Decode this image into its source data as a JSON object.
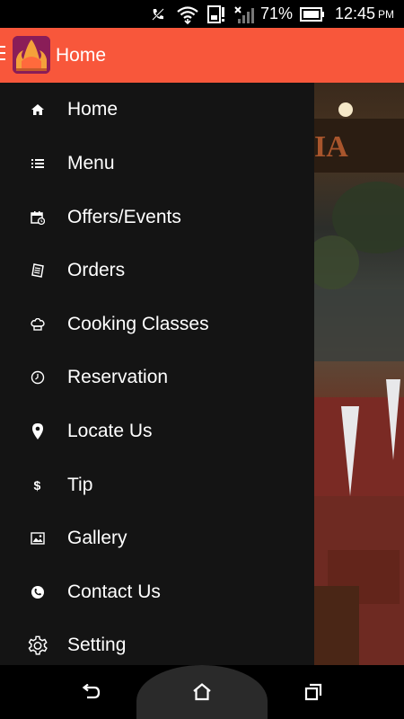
{
  "status_bar": {
    "battery_percent": "71%",
    "time": "12:45",
    "ampm": "PM"
  },
  "app_bar": {
    "title": "Home"
  },
  "drawer": {
    "items": [
      {
        "label": "Home",
        "icon": "home-icon"
      },
      {
        "label": "Menu",
        "icon": "list-icon"
      },
      {
        "label": "Offers/Events",
        "icon": "calendar-icon"
      },
      {
        "label": "Orders",
        "icon": "receipt-icon"
      },
      {
        "label": "Cooking Classes",
        "icon": "chef-hat-icon"
      },
      {
        "label": "Reservation",
        "icon": "clock-icon"
      },
      {
        "label": "Locate Us",
        "icon": "map-pin-icon"
      },
      {
        "label": "Tip",
        "icon": "dollar-icon"
      },
      {
        "label": "Gallery",
        "icon": "image-icon"
      },
      {
        "label": "Contact Us",
        "icon": "phone-icon"
      },
      {
        "label": "Setting",
        "icon": "gear-icon"
      }
    ]
  },
  "colors": {
    "app_bar": "#f8573b",
    "drawer_bg": "#141414",
    "text": "#ffffff"
  }
}
